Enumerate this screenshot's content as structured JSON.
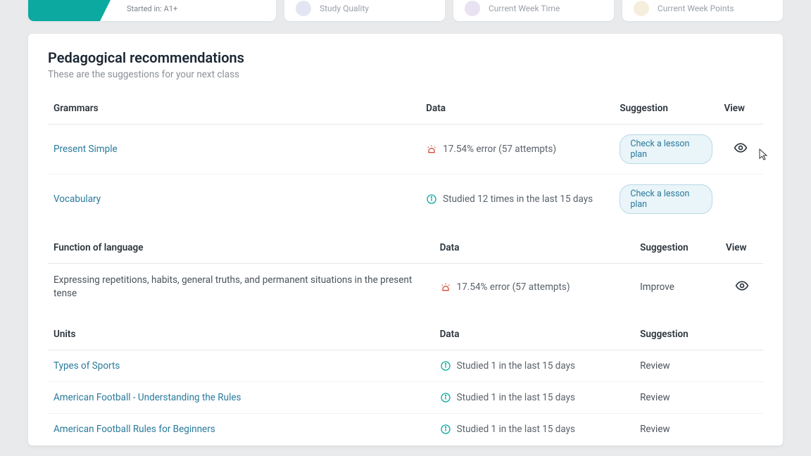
{
  "topCards": {
    "startedIn": "Started in: A1+",
    "studyQuality": "Study Quality",
    "currentWeekTime": "Current Week Time",
    "currentWeekPoints": "Current Week Points"
  },
  "panel": {
    "title": "Pedagogical recommendations",
    "subtitle": "These are the suggestions for your next class"
  },
  "tables": {
    "grammars": {
      "headers": {
        "name": "Grammars",
        "data": "Data",
        "suggestion": "Suggestion",
        "view": "View"
      },
      "rows": [
        {
          "name": "Present Simple",
          "data": "17.54% error (57 attempts)",
          "iconType": "alert",
          "suggestionBtn": "Check a lesson plan",
          "hasView": true,
          "link": true
        },
        {
          "name": "Vocabulary",
          "data": "Studied 12 times in the last 15 days",
          "iconType": "info",
          "suggestionBtn": "Check a lesson plan",
          "hasView": false,
          "link": true
        }
      ]
    },
    "functions": {
      "headers": {
        "name": "Function of language",
        "data": "Data",
        "suggestion": "Suggestion",
        "view": "View"
      },
      "rows": [
        {
          "name": "Expressing repetitions, habits, general truths, and permanent situations in the present tense",
          "data": "17.54% error (57 attempts)",
          "iconType": "alert",
          "suggestion": "Improve",
          "hasView": true,
          "link": false
        }
      ]
    },
    "units": {
      "headers": {
        "name": "Units",
        "data": "Data",
        "suggestion": "Suggestion"
      },
      "rows": [
        {
          "name": "Types of Sports",
          "data": "Studied 1 in the last 15 days",
          "iconType": "info",
          "suggestion": "Review",
          "link": true
        },
        {
          "name": "American Football - Understanding the Rules",
          "data": "Studied 1 in the last 15 days",
          "iconType": "info",
          "suggestion": "Review",
          "link": true
        },
        {
          "name": "American Football Rules for Beginners",
          "data": "Studied 1 in the last 15 days",
          "iconType": "info",
          "suggestion": "Review",
          "link": true
        }
      ]
    }
  }
}
